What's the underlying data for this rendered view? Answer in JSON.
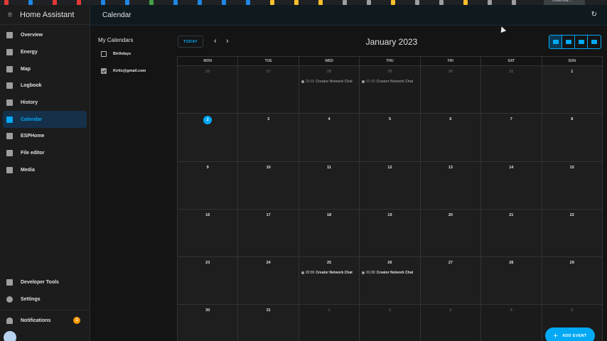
{
  "browser": {
    "active_tab_label": "Calenda..."
  },
  "sidebar": {
    "title": "Home Assistant",
    "items": [
      {
        "label": "Overview",
        "icon": "view-dashboard-icon"
      },
      {
        "label": "Energy",
        "icon": "lightning-bolt-icon"
      },
      {
        "label": "Map",
        "icon": "map-icon"
      },
      {
        "label": "Logbook",
        "icon": "format-list-icon"
      },
      {
        "label": "History",
        "icon": "chart-box-icon"
      },
      {
        "label": "Calendar",
        "icon": "calendar-icon",
        "active": true
      },
      {
        "label": "ESPHome",
        "icon": "esphome-icon"
      },
      {
        "label": "File editor",
        "icon": "wrench-icon"
      },
      {
        "label": "Media",
        "icon": "play-box-icon"
      }
    ],
    "developer_tools": "Developer Tools",
    "settings": "Settings",
    "notifications": "Notifications",
    "notifications_count": "1"
  },
  "header": {
    "title": "Calendar"
  },
  "calendars": {
    "heading": "My Calendars",
    "items": [
      {
        "label": "Birthdays",
        "checked": false
      },
      {
        "label": "Kirils@gmail.com",
        "checked": true
      }
    ]
  },
  "toolbar": {
    "today_label": "TODAY",
    "prev": "‹",
    "next": "›",
    "month_title": "January 2023",
    "views": [
      "month",
      "week",
      "day",
      "list"
    ],
    "selected_view": "month"
  },
  "weekdays": [
    "MON",
    "TUE",
    "WED",
    "THU",
    "FRI",
    "SAT",
    "SUN"
  ],
  "weeks": [
    [
      {
        "n": "26",
        "other": true
      },
      {
        "n": "27",
        "other": true
      },
      {
        "n": "28",
        "other": true,
        "event": {
          "time": "20:00",
          "title": "Creator Network Chat"
        }
      },
      {
        "n": "29",
        "other": true,
        "event": {
          "time": "01:00",
          "title": "Creator Network Chat"
        }
      },
      {
        "n": "30",
        "other": true
      },
      {
        "n": "31",
        "other": true
      },
      {
        "n": "1"
      }
    ],
    [
      {
        "n": "2",
        "today": true
      },
      {
        "n": "3"
      },
      {
        "n": "4"
      },
      {
        "n": "5"
      },
      {
        "n": "6"
      },
      {
        "n": "7"
      },
      {
        "n": "8"
      }
    ],
    [
      {
        "n": "9"
      },
      {
        "n": "10"
      },
      {
        "n": "11"
      },
      {
        "n": "12"
      },
      {
        "n": "13"
      },
      {
        "n": "14"
      },
      {
        "n": "15"
      }
    ],
    [
      {
        "n": "16"
      },
      {
        "n": "17"
      },
      {
        "n": "18"
      },
      {
        "n": "19"
      },
      {
        "n": "20"
      },
      {
        "n": "21"
      },
      {
        "n": "22"
      }
    ],
    [
      {
        "n": "23"
      },
      {
        "n": "24"
      },
      {
        "n": "25",
        "event": {
          "time": "20:00",
          "title": "Creator Network Chat"
        }
      },
      {
        "n": "26",
        "event": {
          "time": "01:00",
          "title": "Creator Network Chat"
        }
      },
      {
        "n": "27"
      },
      {
        "n": "28"
      },
      {
        "n": "29"
      }
    ],
    [
      {
        "n": "30"
      },
      {
        "n": "31"
      },
      {
        "n": "1",
        "other": true
      },
      {
        "n": "2",
        "other": true
      },
      {
        "n": "3",
        "other": true
      },
      {
        "n": "4",
        "other": true
      },
      {
        "n": "5",
        "other": true
      }
    ]
  ],
  "fab": {
    "plus": "+",
    "label": "ADD EVENT"
  },
  "colors": {
    "accent": "#03a9f4",
    "badge": "#ff9800"
  }
}
